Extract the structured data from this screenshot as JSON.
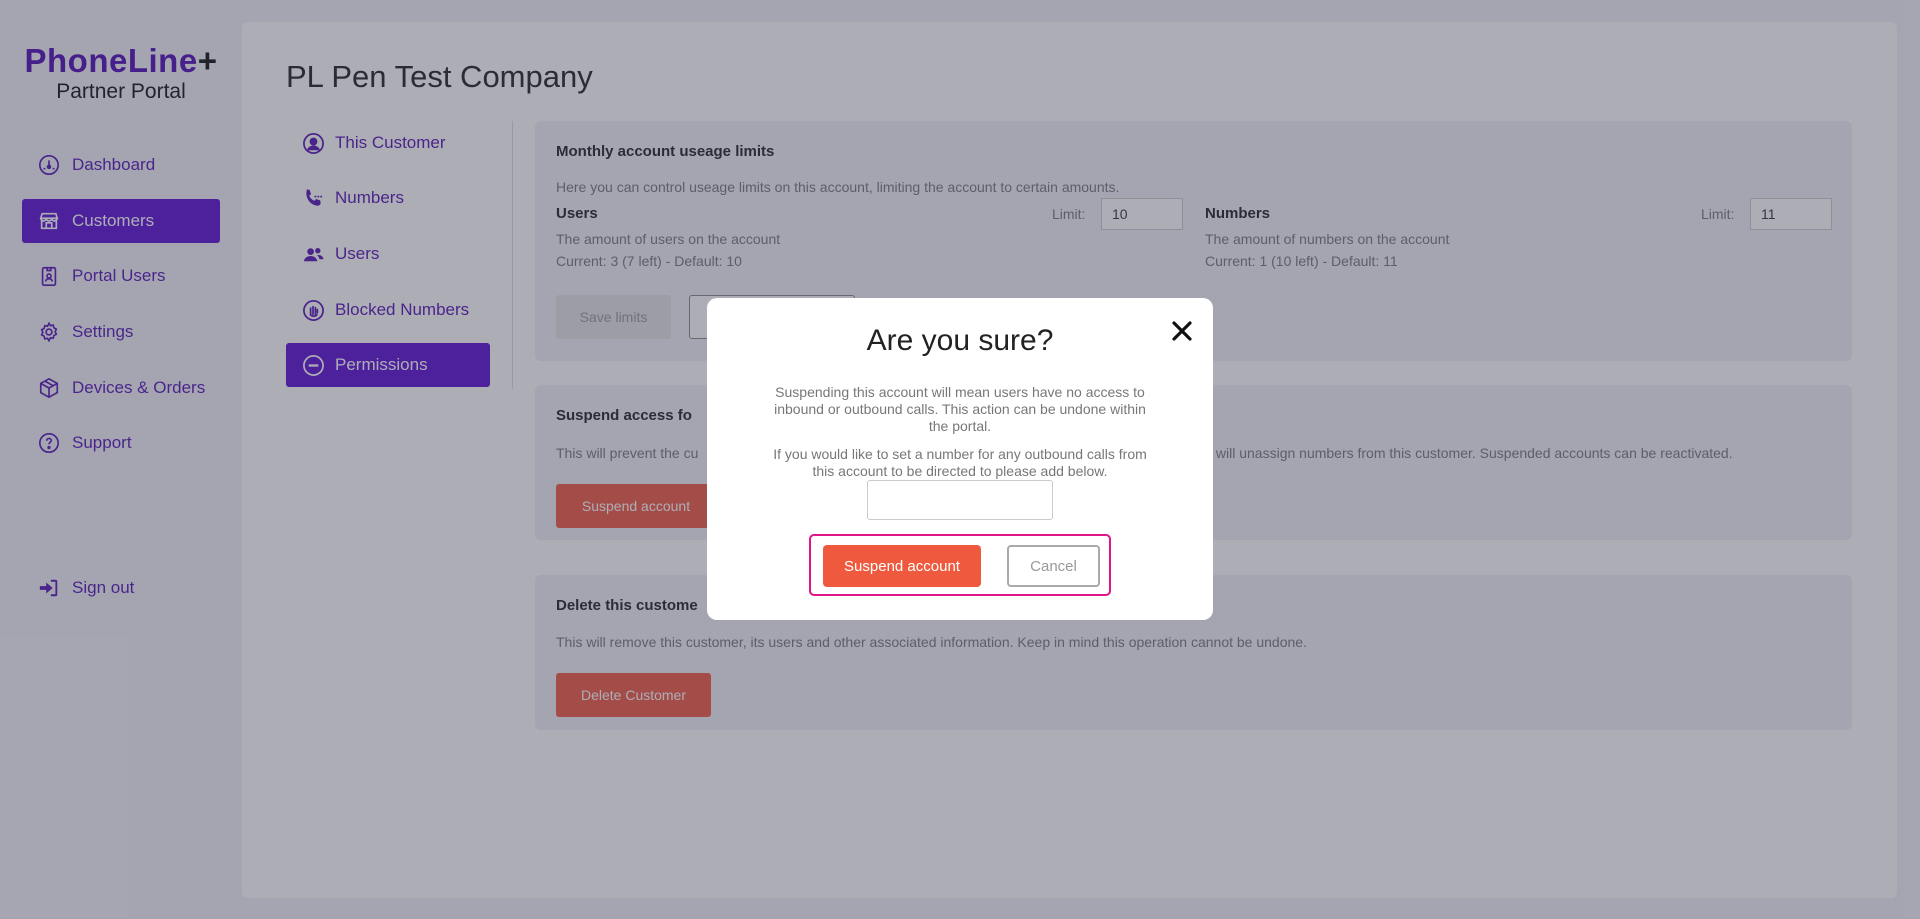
{
  "brand": {
    "name": "PhoneLine",
    "plus": "+",
    "subtitle": "Partner Portal",
    "accent": "#5a0fd1"
  },
  "sidebar": {
    "items": [
      {
        "label": "Dashboard",
        "icon": "dashboard-gauge-icon"
      },
      {
        "label": "Customers",
        "icon": "store-icon",
        "active": true
      },
      {
        "label": "Portal Users",
        "icon": "id-badge-icon"
      },
      {
        "label": "Settings",
        "icon": "gear-icon"
      },
      {
        "label": "Devices & Orders",
        "icon": "box-icon"
      },
      {
        "label": "Support",
        "icon": "question-circle-icon"
      }
    ],
    "signout": {
      "label": "Sign out",
      "icon": "sign-out-icon"
    }
  },
  "page": {
    "title": "PL Pen Test Company"
  },
  "subnav": {
    "items": [
      {
        "label": "This Customer",
        "icon": "user-circle-icon"
      },
      {
        "label": "Numbers",
        "icon": "phone-icon"
      },
      {
        "label": "Users",
        "icon": "users-icon"
      },
      {
        "label": "Blocked Numbers",
        "icon": "blocked-hand-icon"
      },
      {
        "label": "Permissions",
        "icon": "minus-circle-icon",
        "active": true
      }
    ]
  },
  "limits": {
    "title": "Monthly account useage limits",
    "description": "Here you can control useage limits on this account, limiting the account to certain amounts.",
    "users": {
      "label": "Users",
      "desc": "The amount of users on the account",
      "current": "Current: 3 (7 left) - Default: 10",
      "limit_label": "Limit:",
      "limit_value": "10"
    },
    "numbers": {
      "label": "Numbers",
      "desc": "The amount of numbers on the account",
      "current": "Current: 1 (10 left) - Default: 11",
      "limit_label": "Limit:",
      "limit_value": "11"
    },
    "save_label": "Save limits"
  },
  "suspend": {
    "title": "Suspend access fo",
    "desc_left": "This will prevent the cu",
    "desc_right": "s will unassign numbers from this customer. Suspended accounts can be reactivated.",
    "button_label": "Suspend account"
  },
  "delete": {
    "title": "Delete this custome",
    "desc": "This will remove this customer, its users and other associated information. Keep in mind this operation cannot be undone.",
    "button_label": "Delete Customer"
  },
  "modal": {
    "title": "Are you sure?",
    "text1": "Suspending this account will mean users have no access to inbound or outbound calls. This action can be undone within the portal.",
    "text2": "If you would like to set a number for any outbound calls from this account to be directed to please add below.",
    "input_value": "",
    "suspend_label": "Suspend account",
    "cancel_label": "Cancel",
    "highlight_color": "#e0158a"
  }
}
